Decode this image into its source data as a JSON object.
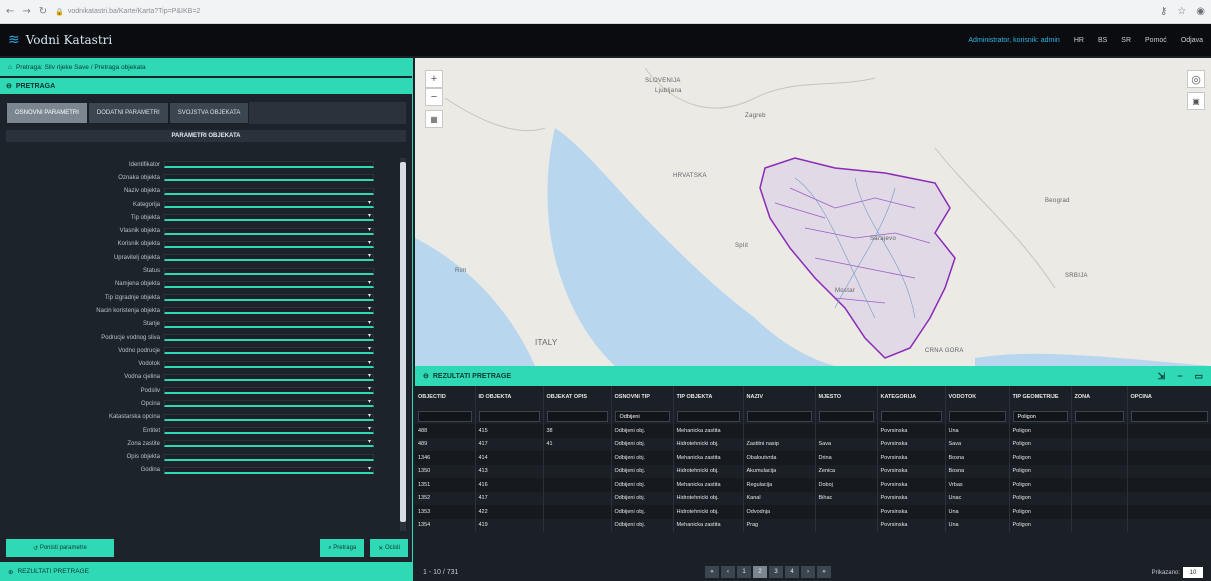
{
  "browser": {
    "url": "vodnikatastri.ba/Karte/Karta?Tip=P&IKB=2",
    "nav": [
      "←",
      "→",
      "C"
    ],
    "right_icons": [
      "key-icon",
      "star-icon",
      "account-icon"
    ]
  },
  "topbar": {
    "app_name": "Vodni Katastri",
    "user": "Administrator, korisnik: admin",
    "nav_items": [
      "HR",
      "BS",
      "SR",
      "Pomoć",
      "Odjava"
    ]
  },
  "left": {
    "crumb": "Pretraga: Sliv rijeke Save / Pretraga objekata",
    "panel_title": "PRETRAGA",
    "tabs": [
      "OSNOVNI PARAMETRI",
      "DODATNI PARAMETRI",
      "SVOJSTVA OBJEKATA"
    ],
    "subhead": "PARAMETRI OBJEKATA",
    "fields": [
      {
        "label": "Identifikator",
        "dropdown": false
      },
      {
        "label": "Oznaka objekta",
        "dropdown": false
      },
      {
        "label": "Naziv objekta",
        "dropdown": false
      },
      {
        "label": "Kategorija",
        "dropdown": true
      },
      {
        "label": "Tip objekta",
        "dropdown": true
      },
      {
        "label": "Vlasnik objekta",
        "dropdown": true
      },
      {
        "label": "Korisnik objekta",
        "dropdown": true
      },
      {
        "label": "Upravitelj objekta",
        "dropdown": true
      },
      {
        "label": "Status",
        "dropdown": false
      },
      {
        "label": "Namjena objekta",
        "dropdown": true
      },
      {
        "label": "Tip izgradnje objekta",
        "dropdown": true
      },
      {
        "label": "Nacin koristenja objekta",
        "dropdown": true
      },
      {
        "label": "Stanje",
        "dropdown": true
      },
      {
        "label": "Podrucje vodnog sliva",
        "dropdown": true
      },
      {
        "label": "Vodno podrucje",
        "dropdown": true
      },
      {
        "label": "Vodotok",
        "dropdown": true
      },
      {
        "label": "Vodna cjelina",
        "dropdown": true
      },
      {
        "label": "Podsliv",
        "dropdown": true
      },
      {
        "label": "Opcina",
        "dropdown": true
      },
      {
        "label": "Katastarska opcina",
        "dropdown": true
      },
      {
        "label": "Entitet",
        "dropdown": true
      },
      {
        "label": "Zona zastite",
        "dropdown": true
      },
      {
        "label": "Opis objekta",
        "dropdown": false
      },
      {
        "label": "Godina",
        "dropdown": true
      }
    ],
    "buttons": {
      "reset": "Ponisti parametre",
      "search": "Pretraga",
      "clear": "Ocisti"
    },
    "footer": "REZULTATI PRETRAGE"
  },
  "map": {
    "labels": [
      "SLOVENIJA",
      "Ljubljana",
      "Zagreb",
      "HRVATSKA",
      "Split",
      "Beograd",
      "Sarajevo",
      "SRBIJA",
      "CRNA GORA",
      "ITALY",
      "Rim",
      "Mostar"
    ]
  },
  "results": {
    "title": "REZULTATI PRETRAGE",
    "columns": [
      "OBJECTID",
      "ID OBJEKTA",
      "OBJEKAT OPIS",
      "OSNOVNI TIP",
      "TIP OBJEKTA",
      "NAZIV",
      "MJESTO",
      "KATEGORIJA",
      "VODOTOK",
      "TIP GEOMETRIJE",
      "ZONA",
      "OPCINA"
    ],
    "filters": [
      "",
      "",
      "",
      "Odbijeni",
      "",
      "",
      "",
      "",
      "",
      "Poligon",
      "",
      ""
    ],
    "rows": [
      [
        "488",
        "415",
        "38",
        "Odbijeni obj.",
        "Mehanicka zastita",
        "",
        "",
        "Povrsinska",
        "Una",
        "Poligon",
        "",
        ""
      ],
      [
        "489",
        "417",
        "41",
        "Odbijeni obj.",
        "Hidrotehnicki obj.",
        "Zastitni nasip",
        "Sava",
        "Povrsinska",
        "Sava",
        "Poligon",
        "",
        ""
      ],
      [
        "1346",
        "414",
        "",
        "Odbijeni obj.",
        "Mehanicka zastita",
        "Obaloutvrda",
        "Drina",
        "Povrsinska",
        "Bosna",
        "Poligon",
        "",
        ""
      ],
      [
        "1350",
        "413",
        "",
        "Odbijeni obj.",
        "Hidrotehnicki obj.",
        "Akumulacija",
        "Zenica",
        "Povrsinska",
        "Bosna",
        "Poligon",
        "",
        ""
      ],
      [
        "1351",
        "416",
        "",
        "Odbijeni obj.",
        "Mehanicka zastita",
        "Regulacija",
        "Doboj",
        "Povrsinska",
        "Vrbas",
        "Poligon",
        "",
        ""
      ],
      [
        "1352",
        "417",
        "",
        "Odbijeni obj.",
        "Hidrotehnicki obj.",
        "Kanal",
        "Bihac",
        "Povrsinska",
        "Unac",
        "Poligon",
        "",
        ""
      ],
      [
        "1353",
        "422",
        "",
        "Odbijeni obj.",
        "Hidrotehnicki obj.",
        "Odvodnja",
        "",
        "Povrsinska",
        "Una",
        "Poligon",
        "",
        ""
      ],
      [
        "1354",
        "419",
        "",
        "Odbijeni obj.",
        "Mehanicka zastita",
        "Prag",
        "",
        "Povrsinska",
        "Una",
        "Poligon",
        "",
        ""
      ]
    ],
    "pager": {
      "range": "1 - 10 / 731",
      "pages": [
        "«",
        "‹",
        "1",
        "2",
        "3",
        "4",
        "›",
        "»"
      ],
      "active_page": "2",
      "page_size_label": "Prikazano:",
      "page_size": "10"
    }
  }
}
